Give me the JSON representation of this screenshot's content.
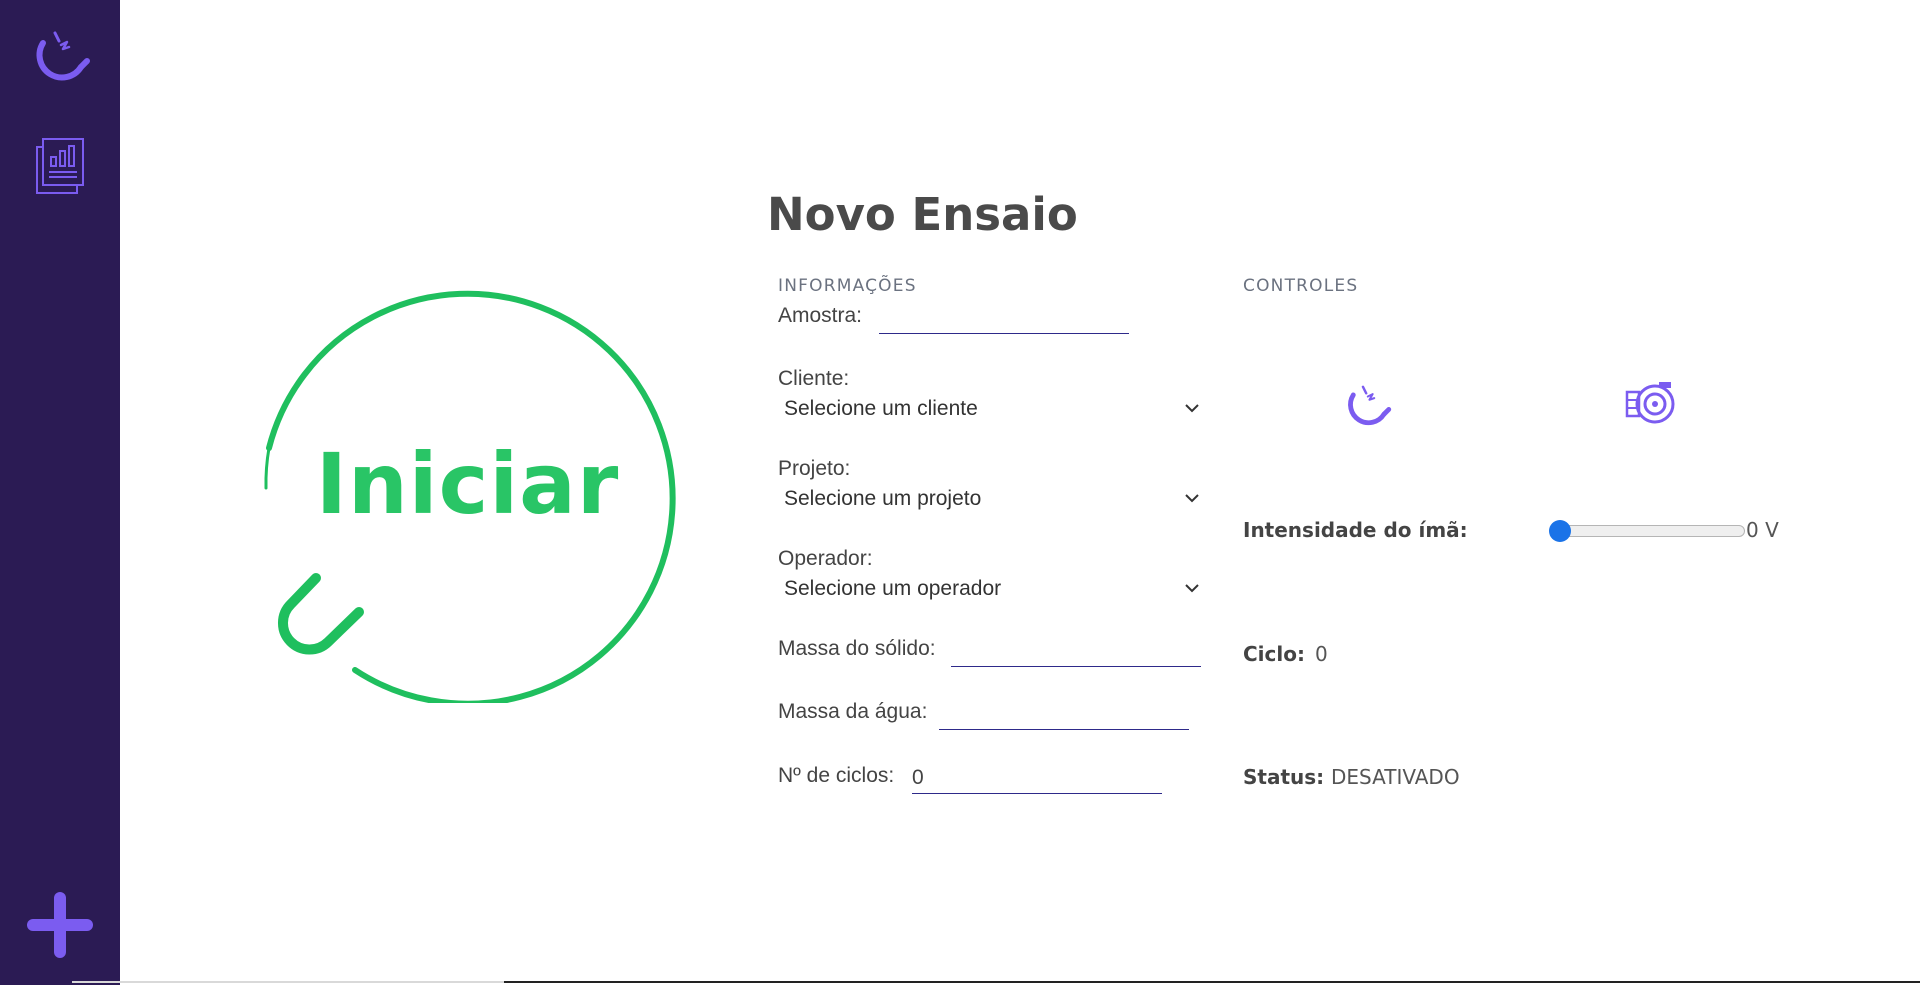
{
  "sidebar": {
    "items": [
      {
        "icon": "magnet-icon"
      },
      {
        "icon": "report-icon"
      }
    ],
    "add_icon": "plus-icon",
    "accent_color": "#7b5cf0",
    "background_color": "#2b1b54"
  },
  "start_button": {
    "label": "Iniciar",
    "color": "#29c566",
    "icon": "magnet-ring-icon"
  },
  "page": {
    "title": "Novo Ensaio"
  },
  "info": {
    "heading": "INFORMAÇÕES",
    "amostra": {
      "label": "Amostra:",
      "value": ""
    },
    "cliente": {
      "label": "Cliente:",
      "selected": "Selecione um cliente"
    },
    "projeto": {
      "label": "Projeto:",
      "selected": "Selecione um projeto"
    },
    "operador": {
      "label": "Operador:",
      "selected": "Selecione um operador"
    },
    "massa_solido": {
      "label": "Massa do sólido:",
      "value": ""
    },
    "massa_agua": {
      "label": "Massa da água:",
      "value": ""
    },
    "num_ciclos": {
      "label": "Nº de ciclos:",
      "value": "0"
    }
  },
  "controls": {
    "heading": "CONTROLES",
    "icons": [
      "magnet-icon",
      "pump-icon"
    ],
    "intensity": {
      "label": "Intensidade do ímã:",
      "value_text": "0 V",
      "fraction": 0
    },
    "cycle": {
      "label": "Ciclo:",
      "value": "0"
    },
    "status": {
      "label": "Status:",
      "value": "DESATIVADO"
    }
  }
}
